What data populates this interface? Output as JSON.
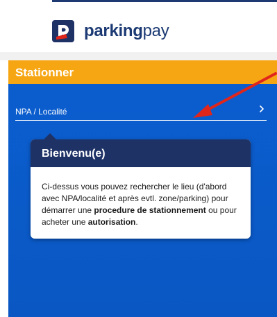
{
  "brand": {
    "name_bold": "parking",
    "name_regular": "pay",
    "colors": {
      "navy": "#1e3266",
      "accent": "#f7a613",
      "panel": "#0a59c6",
      "arrow": "#e0261b"
    }
  },
  "panel": {
    "title": "Stationner",
    "search": {
      "placeholder": "NPA / Localité",
      "icon": "chevron-right-icon"
    }
  },
  "tooltip": {
    "title": "Bienvenu(e)",
    "text_1": "Ci-dessus vous pouvez rechercher le lieu (d'abord avec NPA/localité et après evtl. zone/parking) pour démarrer une ",
    "bold_1": "procedure de stationnement",
    "text_2": " ou pour acheter une ",
    "bold_2": "autorisation",
    "text_3": "."
  }
}
